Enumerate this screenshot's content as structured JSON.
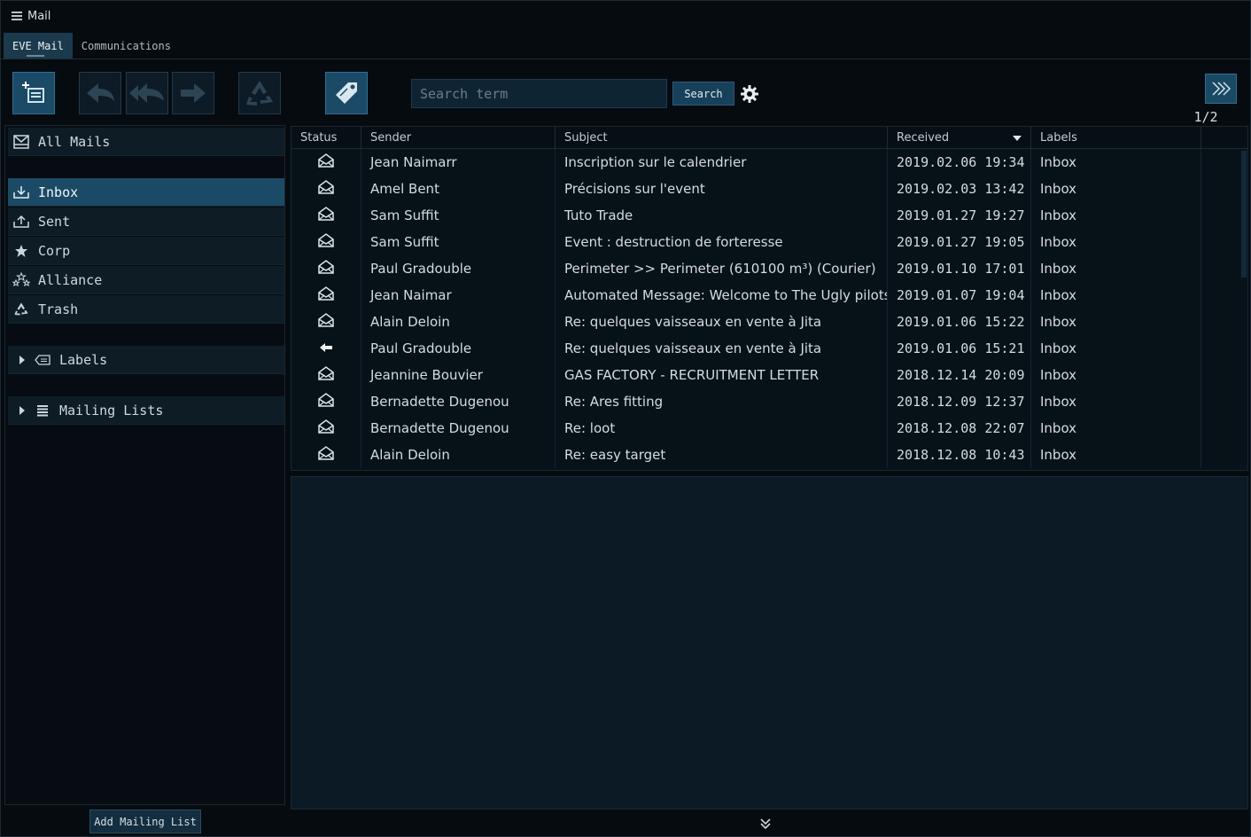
{
  "window": {
    "title": "Mail"
  },
  "tabs": [
    {
      "label": "EVE Mail",
      "active": true
    },
    {
      "label": "Communications",
      "active": false
    }
  ],
  "toolbar": {
    "search_placeholder": "Search term",
    "search_label": "Search",
    "page_indicator": "1/2",
    "icons": [
      "compose-icon",
      "reply-icon",
      "reply-all-icon",
      "forward-icon",
      "recycle-icon",
      "tag-icon",
      "gear-icon",
      "double-chevron-right-icon"
    ]
  },
  "sidebar": {
    "all_mails": "All Mails",
    "folders": [
      {
        "label": "Inbox",
        "icon": "inbox-icon",
        "active": true
      },
      {
        "label": "Sent",
        "icon": "sent-icon",
        "active": false
      },
      {
        "label": "Corp",
        "icon": "star-icon",
        "active": false
      },
      {
        "label": "Alliance",
        "icon": "alliance-icon",
        "active": false
      },
      {
        "label": "Trash",
        "icon": "recycle-icon",
        "active": false
      }
    ],
    "labels_group": "Labels",
    "mailing_lists_group": "Mailing Lists",
    "add_mailing_list": "Add Mailing List"
  },
  "mail_table": {
    "columns": [
      "Status",
      "Sender",
      "Subject",
      "Received",
      "Labels"
    ],
    "sorted_by": "Received",
    "rows": [
      {
        "status": "read",
        "sender": "Jean  Naimarr",
        "subject": "Inscription sur le calendrier",
        "received": "2019.02.06 19:34",
        "labels": "Inbox"
      },
      {
        "status": "read",
        "sender": "Amel Bent",
        "subject": "Précisions sur l'event",
        "received": "2019.02.03 13:42",
        "labels": "Inbox"
      },
      {
        "status": "read",
        "sender": "Sam Suffit",
        "subject": "Tuto Trade",
        "received": "2019.01.27 19:27",
        "labels": "Inbox"
      },
      {
        "status": "read",
        "sender": "Sam Suffit",
        "subject": "Event : destruction de forteresse",
        "received": "2019.01.27 19:05",
        "labels": "Inbox"
      },
      {
        "status": "read",
        "sender": "Paul Gradouble",
        "subject": "Perimeter >> Perimeter (610100 m³) (Courier)",
        "received": "2019.01.10 17:01",
        "labels": "Inbox"
      },
      {
        "status": "read",
        "sender": "Jean Naimar",
        "subject": "Automated Message: Welcome to The Ugly pilots",
        "received": "2019.01.07 19:04",
        "labels": "Inbox"
      },
      {
        "status": "read",
        "sender": "Alain Deloin",
        "subject": "Re: quelques vaisseaux en vente à Jita",
        "received": "2019.01.06 15:22",
        "labels": "Inbox"
      },
      {
        "status": "replied",
        "sender": "Paul Gradouble",
        "subject": "Re: quelques vaisseaux en vente à Jita",
        "received": "2019.01.06 15:21",
        "labels": "Inbox"
      },
      {
        "status": "read",
        "sender": "Jeannine Bouvier",
        "subject": "GAS FACTORY - RECRUITMENT LETTER",
        "received": "2018.12.14 20:09",
        "labels": "Inbox"
      },
      {
        "status": "read",
        "sender": "Bernadette Dugenou",
        "subject": "Re: Ares fitting",
        "received": "2018.12.09 12:37",
        "labels": "Inbox"
      },
      {
        "status": "read",
        "sender": "Bernadette Dugenou",
        "subject": "Re: loot",
        "received": "2018.12.08 22:07",
        "labels": "Inbox"
      },
      {
        "status": "read",
        "sender": "Alain Deloin",
        "subject": "Re: easy target",
        "received": "2018.12.08 10:43",
        "labels": "Inbox"
      }
    ]
  },
  "colors": {
    "background": "#060b10",
    "panel": "#0e1c26",
    "accent": "#1b4a66",
    "text": "#d4dce1"
  }
}
